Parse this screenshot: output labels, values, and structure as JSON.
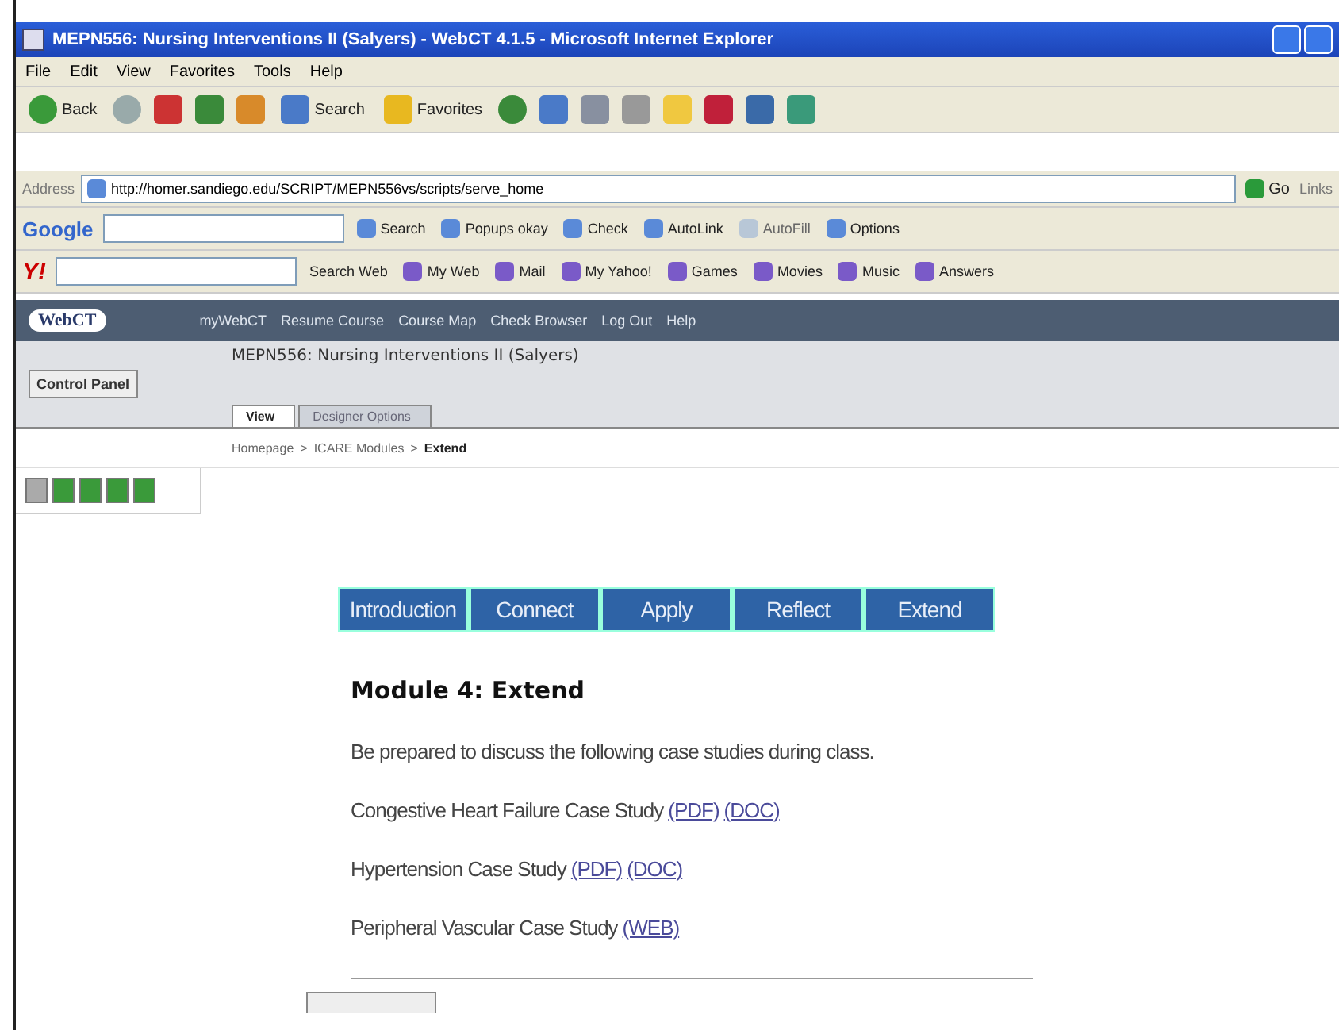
{
  "window": {
    "title": "MEPN556: Nursing Interventions II (Salyers) - WebCT 4.1.5 - Microsoft Internet Explorer"
  },
  "menu": [
    "File",
    "Edit",
    "View",
    "Favorites",
    "Tools",
    "Help"
  ],
  "toolbar": [
    {
      "kind": "back",
      "label": "Back"
    },
    {
      "kind": "forward"
    },
    {
      "kind": "stop"
    },
    {
      "kind": "refresh"
    },
    {
      "kind": "home"
    },
    {
      "kind": "search",
      "label": "Search"
    },
    {
      "kind": "favorites",
      "label": "Favorites"
    },
    {
      "kind": "history"
    },
    {
      "kind": "mail"
    },
    {
      "kind": "print"
    },
    {
      "kind": "edit"
    },
    {
      "kind": "folder"
    },
    {
      "kind": "yahoo"
    },
    {
      "kind": "book"
    },
    {
      "kind": "people"
    }
  ],
  "address": {
    "label": "Address",
    "value": "http://homer.sandiego.edu/SCRIPT/MEPN556vs/scripts/serve_home",
    "go": "Go",
    "links": "Links"
  },
  "google_bar": {
    "logo": "Google",
    "items": [
      {
        "label": "Search",
        "disabled": false
      },
      {
        "label": "Popups okay",
        "disabled": false
      },
      {
        "label": "Check",
        "disabled": false
      },
      {
        "label": "AutoLink",
        "disabled": false
      },
      {
        "label": "AutoFill",
        "disabled": true
      },
      {
        "label": "Options",
        "disabled": false
      }
    ]
  },
  "yahoo_bar": {
    "logo": "Y!",
    "search": "Search Web",
    "items": [
      "My Web",
      "Mail",
      "My Yahoo!",
      "Games",
      "Movies",
      "Music",
      "Answers"
    ]
  },
  "webct": {
    "logo": "WebCT",
    "nav": [
      "myWebCT",
      "Resume Course",
      "Course Map",
      "Check Browser",
      "Log Out",
      "Help"
    ],
    "control_panel": "Control Panel",
    "course_title": "MEPN556: Nursing Interventions II (Salyers)",
    "tabs": [
      {
        "label": "View",
        "selected": true
      },
      {
        "label": "Designer Options",
        "selected": false
      }
    ],
    "breadcrumb": [
      {
        "label": "Homepage",
        "current": false
      },
      {
        "label": "ICARE Modules",
        "current": false
      },
      {
        "label": "Extend",
        "current": true
      }
    ],
    "separator": ">"
  },
  "module_nav": [
    "Introduction",
    "Connect",
    "Apply",
    "Reflect",
    "Extend"
  ],
  "content": {
    "heading": "Module 4: Extend",
    "intro": "Be prepared to discuss the following case studies during class.",
    "studies": [
      {
        "text": "Congestive Heart Failure Case Study",
        "links": [
          "(PDF)",
          "(DOC)"
        ]
      },
      {
        "text": "Hypertension Case Study",
        "links": [
          "(PDF)",
          "(DOC)"
        ]
      },
      {
        "text": "Peripheral Vascular Case Study",
        "links": [
          "(WEB)"
        ]
      }
    ]
  }
}
